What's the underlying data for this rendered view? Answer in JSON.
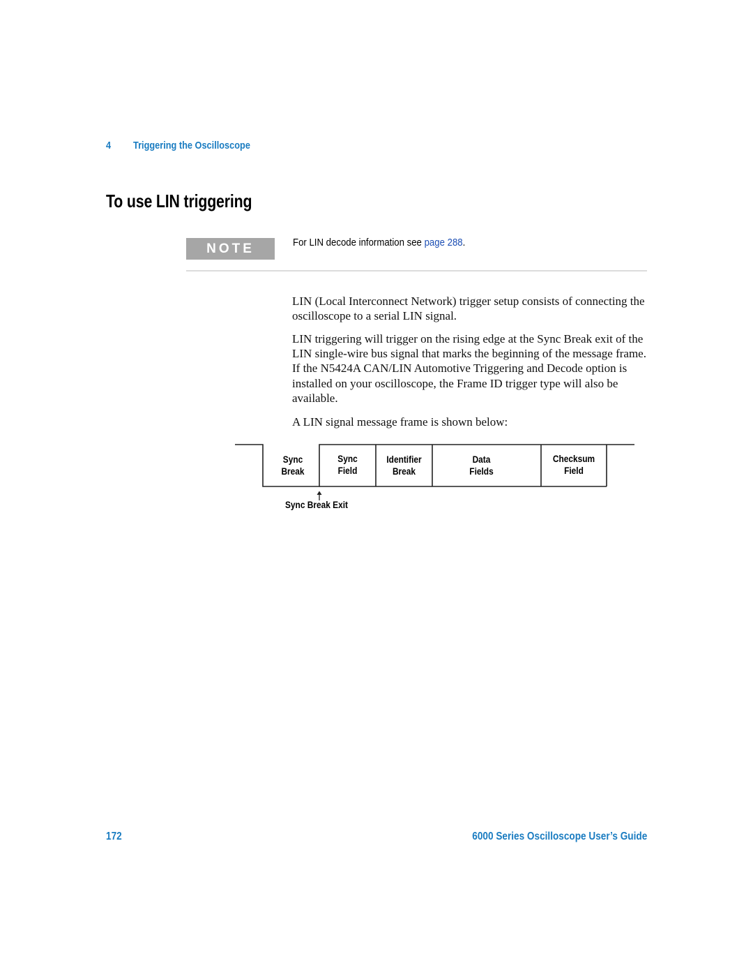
{
  "header": {
    "chapter_number": "4",
    "chapter_title": "Triggering the Oscilloscope"
  },
  "page_title": "To use LIN triggering",
  "note": {
    "badge": "NOTE",
    "text_prefix": "For LIN decode information see ",
    "link_text": "page 288",
    "text_suffix": "."
  },
  "body": {
    "paragraphs": [
      "LIN (Local Interconnect Network) trigger setup consists of connecting the oscilloscope to a serial LIN signal.",
      "LIN triggering will trigger on the rising edge at the Sync Break exit of the LIN single-wire bus signal that marks the beginning of the message frame. If the N5424A CAN/LIN Automotive Triggering and Decode option is installed on your oscilloscope, the Frame ID trigger type will also be available.",
      "A LIN signal message frame is shown below:"
    ]
  },
  "diagram": {
    "fields": [
      {
        "line1": "Sync",
        "line2": "Break"
      },
      {
        "line1": "Sync",
        "line2": "Field"
      },
      {
        "line1": "Identifier",
        "line2": "Break"
      },
      {
        "line1": "Data",
        "line2": "Fields"
      },
      {
        "line1": "Checksum",
        "line2": "Field"
      }
    ],
    "marker_label": "Sync Break Exit",
    "marker_icon": "up-arrow-icon"
  },
  "footer": {
    "page_number": "172",
    "guide_title": "6000 Series Oscilloscope User’s Guide"
  },
  "colors": {
    "accent": "#1a7cc1",
    "link": "#1d4fb4",
    "note_badge": "#a6a6a6"
  }
}
